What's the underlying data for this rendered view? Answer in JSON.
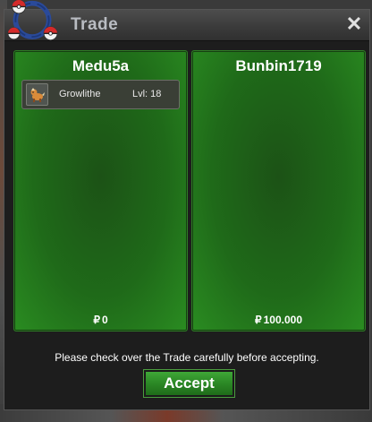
{
  "window": {
    "title": "Trade",
    "close_symbol": "✕"
  },
  "left_panel": {
    "name": "Medu5a",
    "items": [
      {
        "name": "Growlithe",
        "level": "Lvl: 18",
        "icon": "growlithe-sprite-icon"
      }
    ],
    "currency_symbol": "₽",
    "money": "0"
  },
  "right_panel": {
    "name": "Bunbin1719",
    "currency_symbol": "₽",
    "money": "100.000"
  },
  "notice": "Please check over the Trade carefully before accepting.",
  "accept_label": "Accept",
  "colors": {
    "panel_green": "#1f6a19",
    "accept_green": "#2b8825",
    "title_text": "#b9bcc2"
  }
}
